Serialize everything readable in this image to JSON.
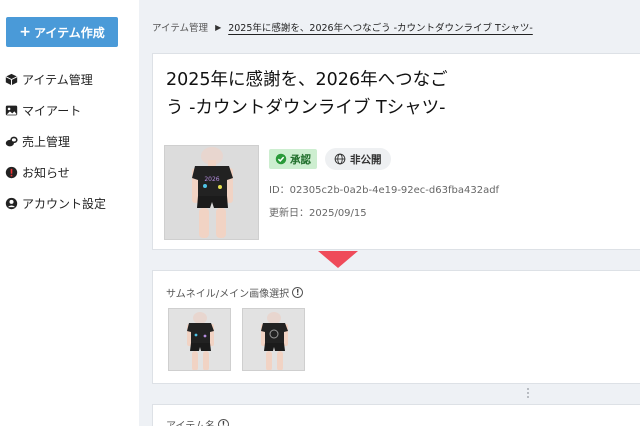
{
  "sidebar": {
    "create_button": "アイテム作成",
    "items": [
      {
        "label": "アイテム管理",
        "icon": "cube-icon"
      },
      {
        "label": "マイアート",
        "icon": "image-icon"
      },
      {
        "label": "売上管理",
        "icon": "coins-icon"
      },
      {
        "label": "お知らせ",
        "icon": "alert-icon"
      },
      {
        "label": "アカウント設定",
        "icon": "user-icon"
      }
    ]
  },
  "breadcrumb": {
    "parent": "アイテム管理",
    "current": "2025年に感謝を、2026年へつなごう -カウントダウンライブ Tシャツ-"
  },
  "item": {
    "title_line1": "2025年に感謝を、2026年へつなご",
    "title_line2": "う -カウントダウンライブ Tシャツ-",
    "status_approved": "承認",
    "status_visibility": "非公開",
    "id_text": "ID：02305c2b-0a2b-4e19-92ec-d63fba432adf",
    "updated_text": "更新日：2025/09/15"
  },
  "thumbnails": {
    "label": "サムネイル/メイン画像選択"
  },
  "name_section": {
    "label": "アイテム名"
  },
  "colors": {
    "accent": "#4a9ad8",
    "approved_bg": "#cdeed0",
    "alert": "#ef4b5a"
  }
}
